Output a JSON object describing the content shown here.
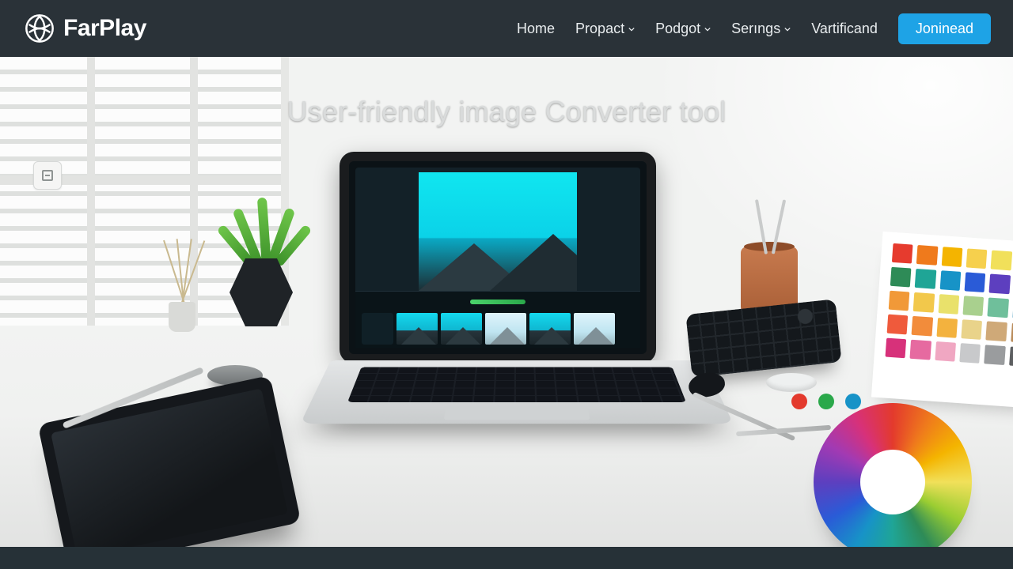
{
  "brand": {
    "name": "FarPlay"
  },
  "nav": {
    "items": [
      {
        "label": "Home",
        "has_submenu": false
      },
      {
        "label": "Propact",
        "has_submenu": true
      },
      {
        "label": "Podgot",
        "has_submenu": true
      },
      {
        "label": "Serıngs",
        "has_submenu": true
      },
      {
        "label": "Vartificand",
        "has_submenu": false
      }
    ],
    "cta_label": "Joninead"
  },
  "hero": {
    "title": "User-friendly image Converter tool"
  },
  "colors": {
    "navbar_bg": "#2a3238",
    "cta_bg": "#1ea3e6",
    "swatches": [
      "#e63b2e",
      "#ef7a1c",
      "#f4b400",
      "#f6d04d",
      "#f1e05a",
      "#c9d84a",
      "#2e8b57",
      "#1fa596",
      "#1793c7",
      "#2a5bd7",
      "#5d3fbf",
      "#a23ab3",
      "#f19938",
      "#f2c84b",
      "#e9e16b",
      "#a9d08e",
      "#6fbf9b",
      "#5aa7c7",
      "#ef5a3c",
      "#f28c3b",
      "#f3b23e",
      "#e9d38a",
      "#cfa978",
      "#b98b5a",
      "#d7317a",
      "#e66aa0",
      "#f0a7c2",
      "#c8c9cb",
      "#9a9c9e",
      "#5d5f61"
    ],
    "wheel_dots": [
      "#e33a2d",
      "#2aa84a",
      "#1793c7"
    ]
  }
}
